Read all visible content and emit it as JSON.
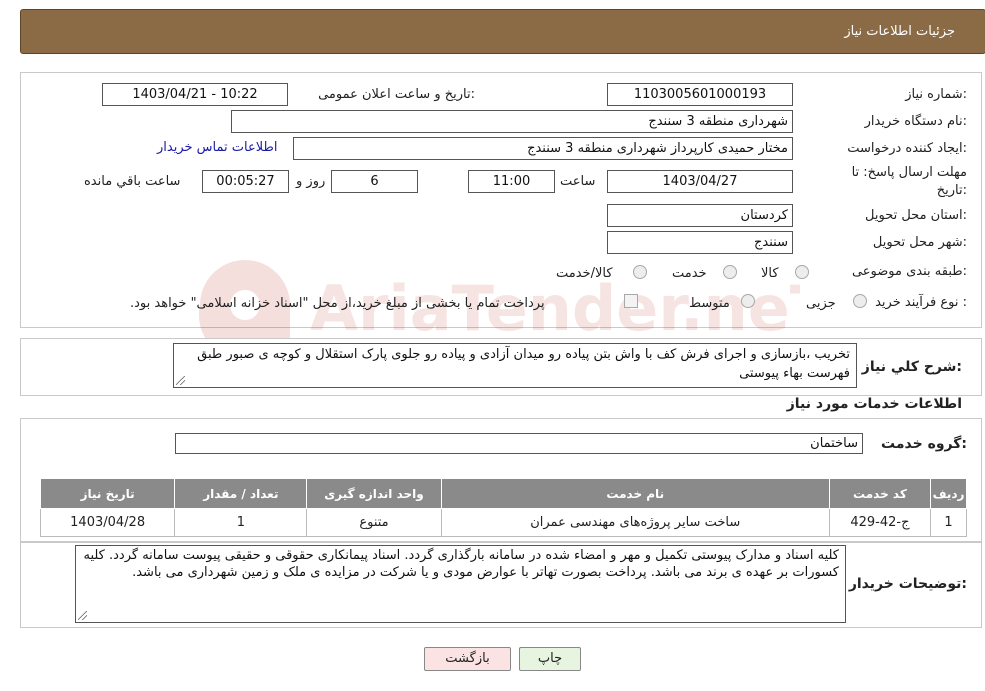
{
  "header": {
    "title": "جزئیات اطلاعات نیاز"
  },
  "form": {
    "need_number_label": "شماره نیاز:",
    "need_number_value": "1103005601000193",
    "announce_label": "تاریخ و ساعت اعلان عمومی:",
    "announce_value": "1403/04/21 - 10:22",
    "buyer_org_label": "نام دستگاه خریدار:",
    "buyer_org_value": "شهرداری منطقه 3 سنندج",
    "creator_label": "ایجاد کننده درخواست:",
    "creator_value": "مختار حمیدی کارپرداز شهرداری منطقه 3 سنندج",
    "contact_link": "اطلاعات تماس خریدار",
    "deadline_label_1": "مهلت ارسال پاسخ: تا",
    "deadline_label_2": "تاریخ:",
    "deadline_date": "1403/04/27",
    "time_label": "ساعت",
    "deadline_time": "11:00",
    "days_value": "6",
    "days_label": "روز و",
    "remaining_value": "00:05:27",
    "remaining_label": "ساعت باقي مانده",
    "province_label": "استان محل تحویل:",
    "province_value": "کردستان",
    "city_label": "شهر محل تحویل:",
    "city_value": "سنندج",
    "category_label": "طبقه بندی موضوعی:",
    "category_options": [
      "کالا",
      "خدمت",
      "کالا/خدمت"
    ],
    "purchase_type_label": "نوع فرآیند خرید :",
    "purchase_options": [
      "جزیی",
      "متوسط"
    ],
    "payment_note": "پرداخت تمام یا بخشی از مبلغ خرید،از محل \"اسناد خزانه اسلامی\" خواهد بود."
  },
  "description": {
    "label": "شرح کلي نياز:",
    "text": "تخریب ،بازسازی و اجرای فرش کف با واش بتن پیاده رو میدان آزادی و پیاده رو جلوی پارک استقلال و کوچه ی صبور طبق فهرست بهاء پیوستی"
  },
  "services": {
    "section_title": "اطلاعات خدمات مورد نياز",
    "group_label": "گروه خدمت:",
    "group_value": "ساختمان",
    "columns": [
      "ردیف",
      "کد خدمت",
      "نام خدمت",
      "واحد اندازه گیری",
      "تعداد / مقدار",
      "تاریخ نیاز"
    ],
    "rows": [
      [
        "1",
        "ج-42-429",
        "ساخت سایر پروژه‌های مهندسی عمران",
        "متنوع",
        "1",
        "1403/04/28"
      ]
    ]
  },
  "buyer_notes": {
    "label": "توضیحات خریدار:",
    "text": "کلیه اسناد و مدارک پیوستی تکمیل و مهر و امضاء شده در سامانه بارگذاری گردد. اسناد پیمانکاری حقوقی و حقیقی پیوست سامانه گردد. کلیه کسورات بر عهده ی برند می باشد. پرداخت بصورت تهاتر با عوارض مودی و یا شرکت در مزایده ی ملک و زمین شهرداری می باشد."
  },
  "buttons": {
    "print": "چاپ",
    "back": "بازگشت"
  },
  "watermark": {
    "text": "AriaTender.neT"
  },
  "colors": {
    "header_bg": "#8b6b46",
    "link": "#1a1aa6",
    "table_header": "#8a8a8a",
    "back_button": "#fbe3e3",
    "print_button": "#e6f4e0"
  }
}
